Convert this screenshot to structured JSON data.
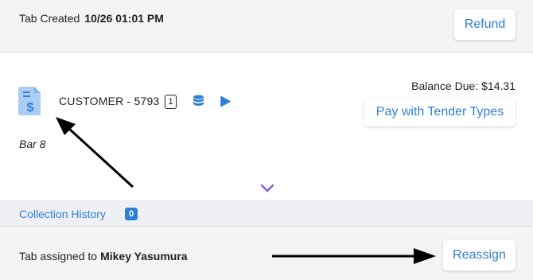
{
  "header": {
    "created_label": "Tab Created",
    "created_value": "10/26 01:01 PM",
    "refund_label": "Refund"
  },
  "tab": {
    "customer_label": "CUSTOMER - 5793",
    "guest_count": "1",
    "location": "Bar 8",
    "balance_label": "Balance Due:",
    "balance_value": "$14.31",
    "pay_label": "Pay with Tender Types"
  },
  "collection": {
    "title": "Collection History",
    "count": "0"
  },
  "footer": {
    "assigned_label": "Tab assigned to",
    "assigned_name": "Mikey Yasumura",
    "reassign_label": "Reassign"
  },
  "colors": {
    "accent": "#2f7fd6",
    "chevron": "#8a5cd6",
    "icon_light": "#a9cdf5"
  },
  "icons": [
    "receipt-dollar-icon",
    "database-icon",
    "play-icon",
    "chevron-down-icon",
    "annotation-arrow"
  ]
}
